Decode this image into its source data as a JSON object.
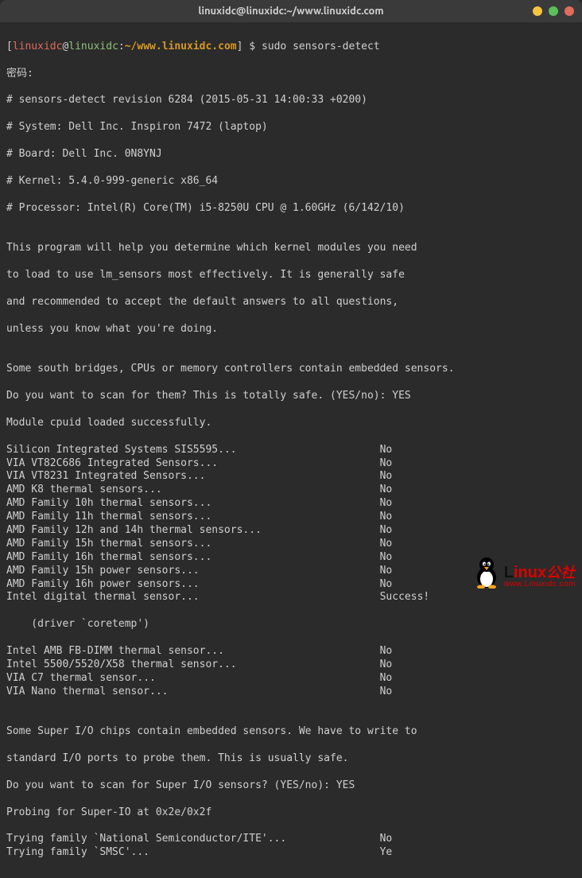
{
  "titlebar": {
    "title": "linuxidc@linuxidc:~/www.linuxidc.com"
  },
  "prompt": {
    "open": "[",
    "user": "linuxidc",
    "at": "@",
    "host": "linuxidc",
    "colon": ":",
    "path": "~/www.linuxidc.com",
    "close": "]",
    "dollar": " $ ",
    "command": "sudo sensors-detect"
  },
  "lines": {
    "pw": "密码:",
    "rev": "# sensors-detect revision 6284 (2015-05-31 14:00:33 +0200)",
    "sys": "# System: Dell Inc. Inspiron 7472 (laptop)",
    "board": "# Board: Dell Inc. 0N8YNJ",
    "kernel": "# Kernel: 5.4.0-999-generic x86_64",
    "proc": "# Processor: Intel(R) Core(TM) i5-8250U CPU @ 1.60GHz (6/142/10)",
    "blank": "",
    "intro1": "This program will help you determine which kernel modules you need",
    "intro2": "to load to use lm_sensors most effectively. It is generally safe",
    "intro3": "and recommended to accept the default answers to all questions,",
    "intro4": "unless you know what you're doing.",
    "south1": "Some south bridges, CPUs or memory controllers contain embedded sensors.",
    "south2": "Do you want to scan for them? This is totally safe. (YES/no): YES",
    "cpuid": "Module cpuid loaded successfully.",
    "driver": "    (driver `coretemp')",
    "super1": "Some Super I/O chips contain embedded sensors. We have to write to",
    "super2": "standard I/O ports to probe them. This is usually safe.",
    "super3": "Do you want to scan for Super I/O sensors? (YES/no): YES",
    "probe": "Probing for Super-IO at 0x2e/0x2f"
  },
  "sensors": [
    {
      "name": "Silicon Integrated Systems SIS5595...                       ",
      "result": "No"
    },
    {
      "name": "VIA VT82C686 Integrated Sensors...                          ",
      "result": "No"
    },
    {
      "name": "VIA VT8231 Integrated Sensors...                            ",
      "result": "No"
    },
    {
      "name": "AMD K8 thermal sensors...                                   ",
      "result": "No"
    },
    {
      "name": "AMD Family 10h thermal sensors...                           ",
      "result": "No"
    },
    {
      "name": "AMD Family 11h thermal sensors...                           ",
      "result": "No"
    },
    {
      "name": "AMD Family 12h and 14h thermal sensors...                   ",
      "result": "No"
    },
    {
      "name": "AMD Family 15h thermal sensors...                           ",
      "result": "No"
    },
    {
      "name": "AMD Family 16h thermal sensors...                           ",
      "result": "No"
    },
    {
      "name": "AMD Family 15h power sensors...                             ",
      "result": "No"
    },
    {
      "name": "AMD Family 16h power sensors...                             ",
      "result": "No"
    },
    {
      "name": "Intel digital thermal sensor...                             ",
      "result": "Success!"
    }
  ],
  "sensors2": [
    {
      "name": "Intel AMB FB-DIMM thermal sensor...                         ",
      "result": "No"
    },
    {
      "name": "Intel 5500/5520/X58 thermal sensor...                       ",
      "result": "No"
    },
    {
      "name": "VIA C7 thermal sensor...                                    ",
      "result": "No"
    },
    {
      "name": "VIA Nano thermal sensor...                                  ",
      "result": "No"
    }
  ],
  "trying": [
    {
      "name": "Trying family `National Semiconductor/ITE'...               ",
      "result": "No"
    },
    {
      "name": "Trying family `SMSC'...                                     ",
      "result": "Ye"
    }
  ],
  "watermark": {
    "main_l": "L",
    "main_inux": "inux",
    "main_cn": "公社",
    "sub": "www.Linuxidc.com"
  }
}
